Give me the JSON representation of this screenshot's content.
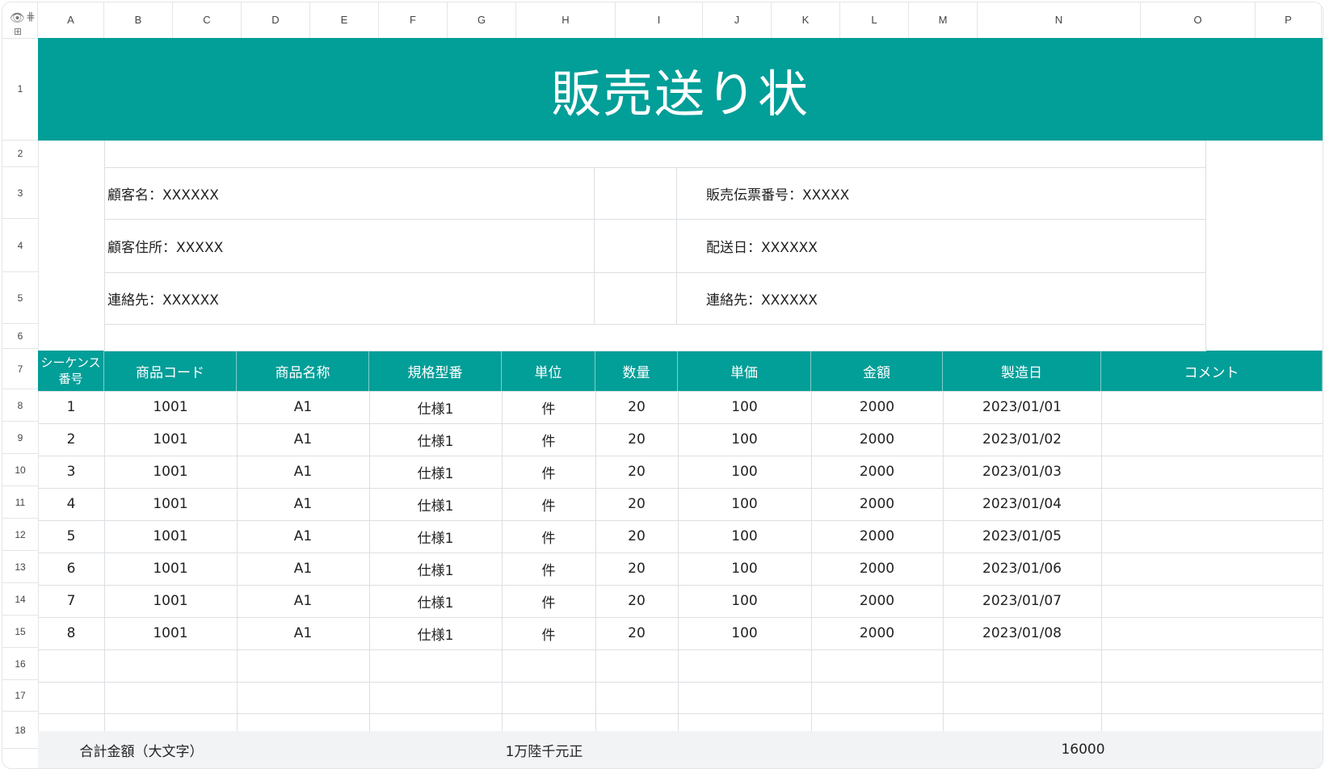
{
  "column_headers": [
    "A",
    "B",
    "C",
    "D",
    "E",
    "F",
    "G",
    "H",
    "I",
    "J",
    "K",
    "L",
    "M",
    "N",
    "O",
    "P"
  ],
  "row_numbers": [
    "1",
    "2",
    "3",
    "4",
    "5",
    "6",
    "7",
    "8",
    "9",
    "10",
    "11",
    "12",
    "13",
    "14",
    "15",
    "16",
    "17",
    "18"
  ],
  "toolbar_icons": [
    "eye-icon",
    "freeze-icon",
    "grid-icon"
  ],
  "title": "販売送り状",
  "info": {
    "customer_name": "顧客名：XXXXXX",
    "customer_address": "顧客住所：XXXXX",
    "contact_left": "連絡先：XXXXXX",
    "slip_number": "販売伝票番号：XXXXX",
    "delivery_date": "配送日：XXXXXX",
    "contact_right": "連絡先：XXXXXX"
  },
  "table": {
    "headers": {
      "seq": "シーケンス番号",
      "product_code": "商品コード",
      "product_name": "商品名称",
      "spec": "規格型番",
      "unit": "単位",
      "qty": "数量",
      "unit_price": "単価",
      "amount": "金額",
      "mfg_date": "製造日",
      "comment": "コメント"
    },
    "rows": [
      {
        "seq": "1",
        "product_code": "1001",
        "product_name": "A1",
        "spec": "仕様1",
        "unit": "件",
        "qty": "20",
        "unit_price": "100",
        "amount": "2000",
        "mfg_date": "2023/01/01",
        "comment": ""
      },
      {
        "seq": "2",
        "product_code": "1001",
        "product_name": "A1",
        "spec": "仕様1",
        "unit": "件",
        "qty": "20",
        "unit_price": "100",
        "amount": "2000",
        "mfg_date": "2023/01/02",
        "comment": ""
      },
      {
        "seq": "3",
        "product_code": "1001",
        "product_name": "A1",
        "spec": "仕様1",
        "unit": "件",
        "qty": "20",
        "unit_price": "100",
        "amount": "2000",
        "mfg_date": "2023/01/03",
        "comment": ""
      },
      {
        "seq": "4",
        "product_code": "1001",
        "product_name": "A1",
        "spec": "仕様1",
        "unit": "件",
        "qty": "20",
        "unit_price": "100",
        "amount": "2000",
        "mfg_date": "2023/01/04",
        "comment": ""
      },
      {
        "seq": "5",
        "product_code": "1001",
        "product_name": "A1",
        "spec": "仕様1",
        "unit": "件",
        "qty": "20",
        "unit_price": "100",
        "amount": "2000",
        "mfg_date": "2023/01/05",
        "comment": ""
      },
      {
        "seq": "6",
        "product_code": "1001",
        "product_name": "A1",
        "spec": "仕様1",
        "unit": "件",
        "qty": "20",
        "unit_price": "100",
        "amount": "2000",
        "mfg_date": "2023/01/06",
        "comment": ""
      },
      {
        "seq": "7",
        "product_code": "1001",
        "product_name": "A1",
        "spec": "仕様1",
        "unit": "件",
        "qty": "20",
        "unit_price": "100",
        "amount": "2000",
        "mfg_date": "2023/01/07",
        "comment": ""
      },
      {
        "seq": "8",
        "product_code": "1001",
        "product_name": "A1",
        "spec": "仕様1",
        "unit": "件",
        "qty": "20",
        "unit_price": "100",
        "amount": "2000",
        "mfg_date": "2023/01/08",
        "comment": ""
      }
    ]
  },
  "total": {
    "label": "合計金額（大文字）",
    "amount_words": "1万陸千元正",
    "amount": "16000"
  },
  "colors": {
    "accent": "#029e98",
    "grid": "#dcdfe3",
    "total_bg": "#f2f3f5"
  }
}
